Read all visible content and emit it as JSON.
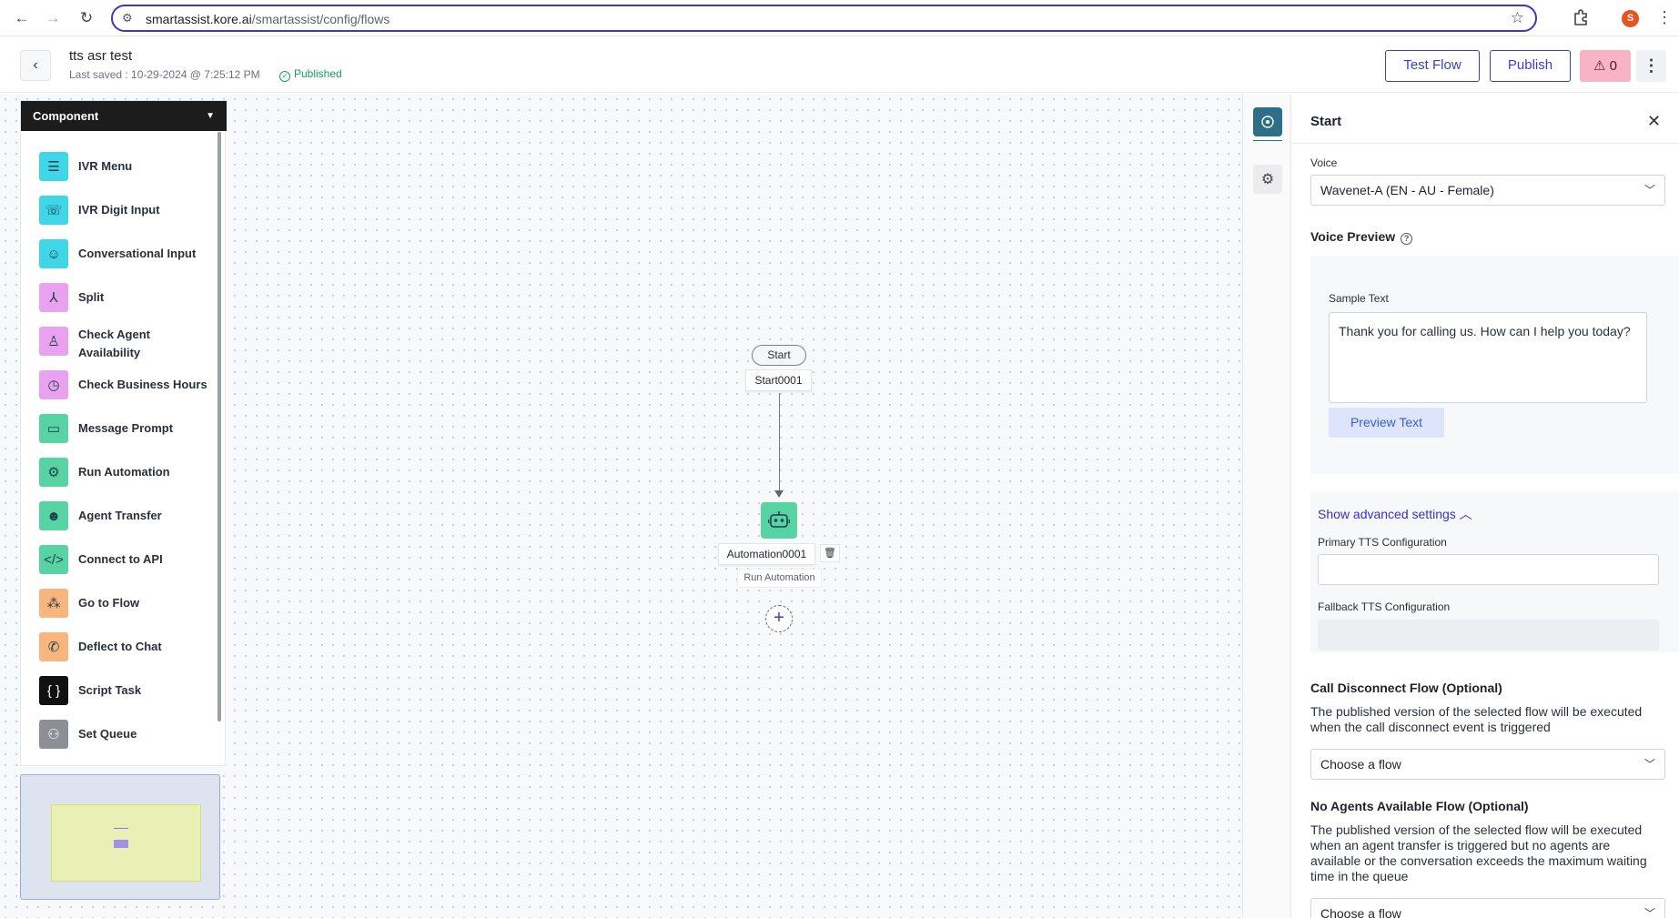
{
  "browser": {
    "url_host": "smartassist.kore.ai",
    "url_path": "/smartassist/config/flows",
    "profile_initial": "S"
  },
  "header": {
    "title": "tts asr test",
    "last_saved": "Last saved : 10-29-2024 @ 7:25:12 PM",
    "status": "Published",
    "test_flow_label": "Test Flow",
    "publish_label": "Publish",
    "warnings_count": "0"
  },
  "components": {
    "title": "Component",
    "items": [
      {
        "label": "IVR Menu",
        "icon": "ivr-menu-icon",
        "color": "#3fd7e8"
      },
      {
        "label": "IVR Digit Input",
        "icon": "ivr-digit-input-icon",
        "color": "#3fd7e8"
      },
      {
        "label": "Conversational Input",
        "icon": "conversational-input-icon",
        "color": "#3fd7e8"
      },
      {
        "label": "Split",
        "icon": "split-icon",
        "color": "#e9a2f0"
      },
      {
        "label": "Check Agent Availability",
        "icon": "check-agent-availability-icon",
        "color": "#e9a2f0"
      },
      {
        "label": "Check Business Hours",
        "icon": "check-business-hours-icon",
        "color": "#e9a2f0"
      },
      {
        "label": "Message Prompt",
        "icon": "message-prompt-icon",
        "color": "#58d3a3"
      },
      {
        "label": "Run Automation",
        "icon": "run-automation-icon",
        "color": "#58d3a3"
      },
      {
        "label": "Agent Transfer",
        "icon": "agent-transfer-icon",
        "color": "#58d3a3"
      },
      {
        "label": "Connect to API",
        "icon": "connect-to-api-icon",
        "color": "#58d3a3"
      },
      {
        "label": "Go to Flow",
        "icon": "go-to-flow-icon",
        "color": "#f8b67e"
      },
      {
        "label": "Deflect to Chat",
        "icon": "deflect-to-chat-icon",
        "color": "#f8b67e"
      },
      {
        "label": "Script Task",
        "icon": "script-task-icon",
        "color": "#111111"
      },
      {
        "label": "Set Queue",
        "icon": "set-queue-icon",
        "color": "#8c8f96"
      }
    ]
  },
  "flow": {
    "start_pill": "Start",
    "start_node": "Start0001",
    "automation_node": "Automation0001",
    "automation_type": "Run Automation"
  },
  "properties": {
    "title": "Start",
    "voice_label": "Voice",
    "voice_value": "Wavenet-A (EN - AU - Female)",
    "voice_preview_heading": "Voice Preview",
    "sample_text_label": "Sample Text",
    "sample_text_value": "Thank you for calling us. How can I help you today?",
    "preview_button": "Preview Text",
    "advanced_link": "Show advanced settings",
    "primary_tts_label": "Primary TTS Configuration",
    "primary_tts_value": "",
    "fallback_tts_label": "Fallback TTS Configuration",
    "fallback_tts_value": "",
    "call_disconnect_heading": "Call Disconnect Flow (Optional)",
    "call_disconnect_desc": "The published version of the selected flow will be executed when the call disconnect event is triggered",
    "call_disconnect_select": "Choose a flow",
    "no_agents_heading": "No Agents Available Flow (Optional)",
    "no_agents_desc": "The published version of the selected flow will be executed when an agent transfer is triggered but no agents are available or the conversation exceeds the maximum waiting time in the queue",
    "no_agents_select": "Choose a flow"
  },
  "colors": {
    "accent": "#3b3ec8",
    "published": "#15a05a",
    "warning_bg": "#f8b4c6",
    "rail_active": "#2c6f86"
  }
}
